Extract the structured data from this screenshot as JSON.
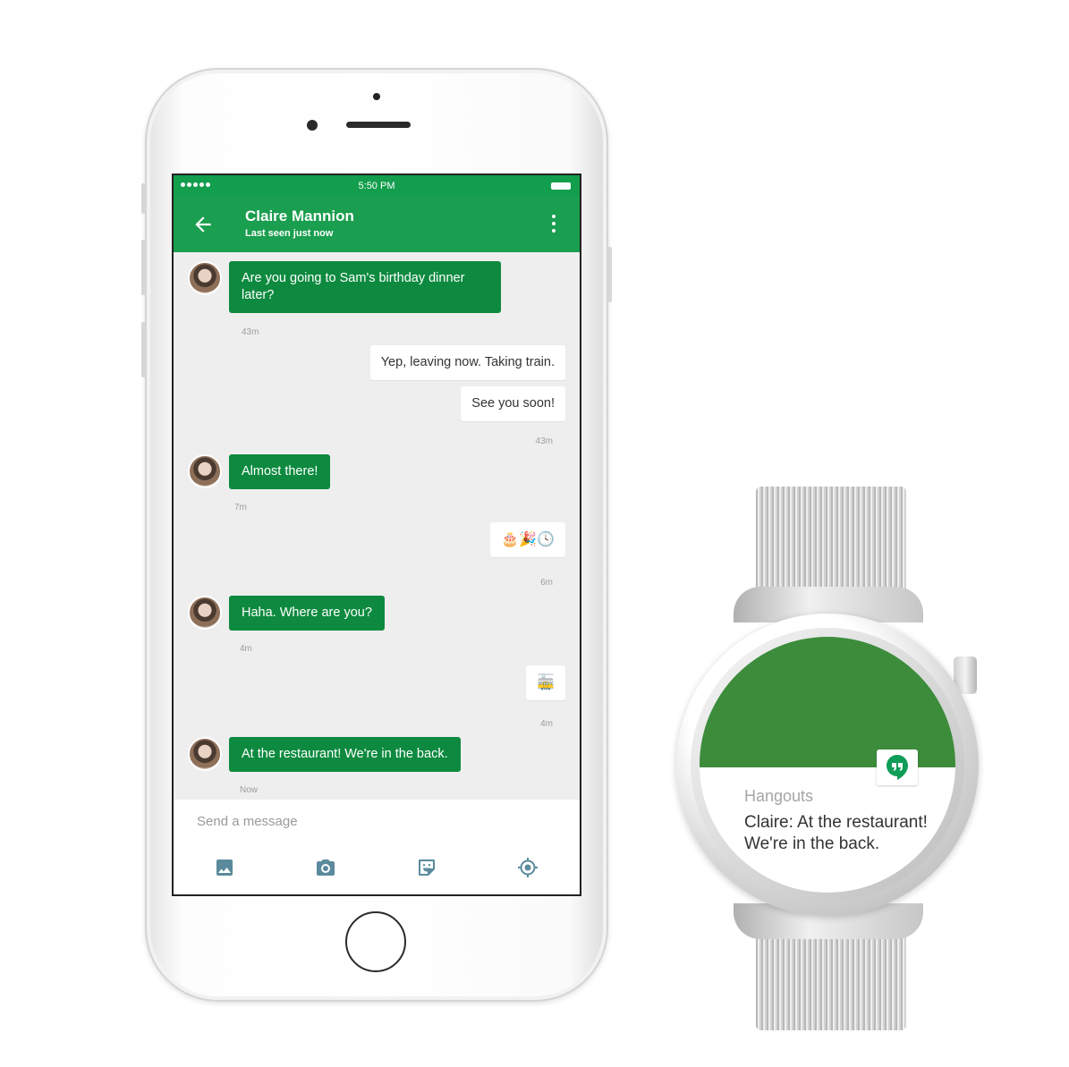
{
  "phone": {
    "status_bar": {
      "time": "5:50 PM"
    },
    "app_bar": {
      "contact_name": "Claire Mannion",
      "contact_status": "Last seen just now"
    },
    "messages": [
      {
        "direction": "incoming",
        "text": "Are you going to Sam's birthday dinner later?",
        "time": "43m"
      },
      {
        "direction": "outgoing",
        "text": "Yep, leaving now. Taking train."
      },
      {
        "direction": "outgoing",
        "text": "See you soon!",
        "time": "43m"
      },
      {
        "direction": "incoming",
        "text": "Almost there!",
        "time": "7m"
      },
      {
        "direction": "outgoing",
        "text": "🎂🎉🕓",
        "time": "6m"
      },
      {
        "direction": "incoming",
        "text": "Haha. Where are you?",
        "time": "4m"
      },
      {
        "direction": "outgoing",
        "text": "🚋",
        "time": "4m"
      },
      {
        "direction": "incoming",
        "text": "At the restaurant! We're in the back.",
        "time": "Now"
      }
    ],
    "composer": {
      "placeholder": "Send a message",
      "tools": [
        "image-icon",
        "camera-icon",
        "sticker-icon",
        "location-icon"
      ]
    }
  },
  "watch": {
    "notification": {
      "app_name": "Hangouts",
      "text": "Claire: At the restaurant! We're in the back."
    }
  },
  "colors": {
    "primary_green": "#1a9e4f",
    "bubble_green": "#0d8a3f",
    "watch_green": "#3c8c3c"
  }
}
